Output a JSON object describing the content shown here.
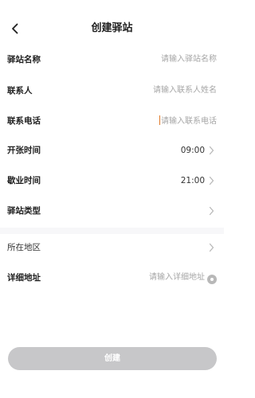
{
  "header": {
    "title": "创建驿站",
    "back_icon": "chevron-left-icon"
  },
  "form": {
    "station_name": {
      "label": "驿站名称",
      "placeholder": "请输入驿站名称"
    },
    "contact_person": {
      "label": "联系人",
      "placeholder": "请输入联系人姓名"
    },
    "contact_phone": {
      "label": "联系电话",
      "placeholder": "请输入联系电话"
    },
    "open_time": {
      "label": "开张时间",
      "value": "09:00"
    },
    "close_time": {
      "label": "歇业时间",
      "value": "21:00"
    },
    "station_type": {
      "label": "驿站类型",
      "value": ""
    },
    "region": {
      "label": "所在地区",
      "value": ""
    },
    "address": {
      "label": "详细地址",
      "placeholder": "请输入详细地址",
      "icon": "location-pin-icon"
    }
  },
  "actions": {
    "create_label": "创建"
  },
  "colors": {
    "button_disabled": "#c7c7c9",
    "placeholder": "#a6a6a6",
    "cursor": "#e07a2a"
  }
}
